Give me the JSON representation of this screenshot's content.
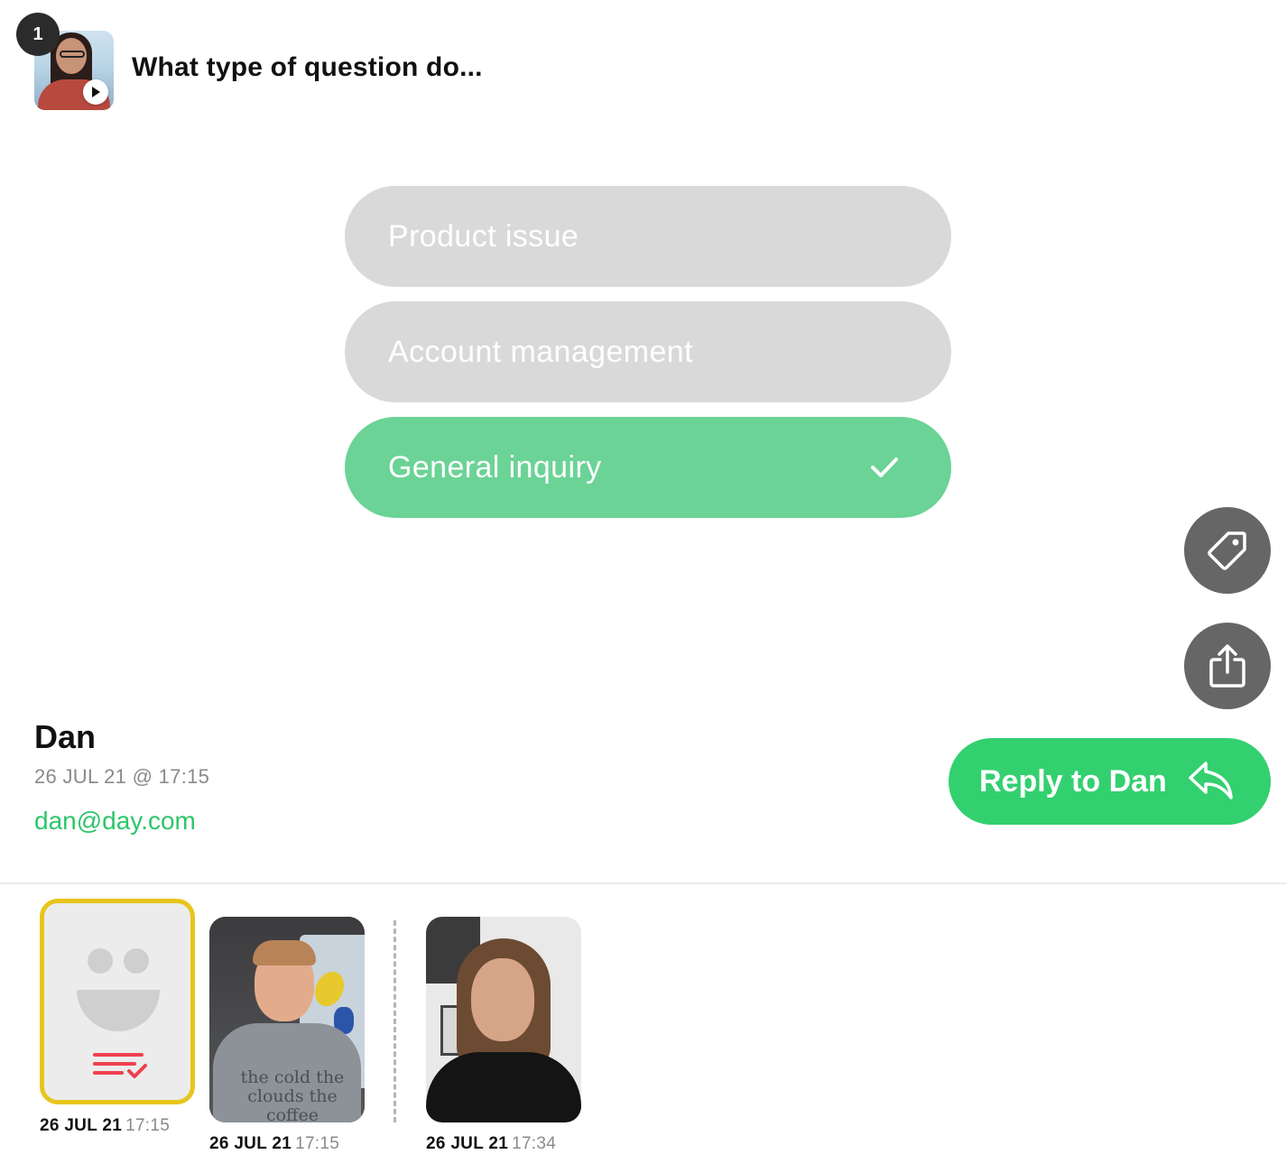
{
  "question": {
    "number": "1",
    "title": "What type of question do..."
  },
  "options": [
    {
      "label": "Product issue",
      "selected": false
    },
    {
      "label": "Account management",
      "selected": false
    },
    {
      "label": "General inquiry",
      "selected": true
    }
  ],
  "actions": {
    "tag_icon": "tag-icon",
    "share_icon": "share-icon"
  },
  "responder": {
    "name": "Dan",
    "date": "26 JUL 21 @ 17:15",
    "email": "dan@day.com"
  },
  "reply": {
    "label": "Reply to Dan",
    "icon": "reply-icon"
  },
  "thumbnails": [
    {
      "date": "26 JUL 21",
      "time": "17:15",
      "kind": "form-response",
      "selected": true
    },
    {
      "date": "26 JUL 21",
      "time": "17:15",
      "kind": "video",
      "shirt_text": "the cold the clouds the coffee"
    },
    {
      "date": "26 JUL 21",
      "time": "17:34",
      "kind": "video"
    }
  ],
  "colors": {
    "option_default": "#d9d9d9",
    "option_selected": "#6bd396",
    "accent_green": "#33d06f",
    "email_green": "#2dc66a",
    "selected_border": "#e8c51c",
    "list_icon_red": "#f0404f"
  }
}
